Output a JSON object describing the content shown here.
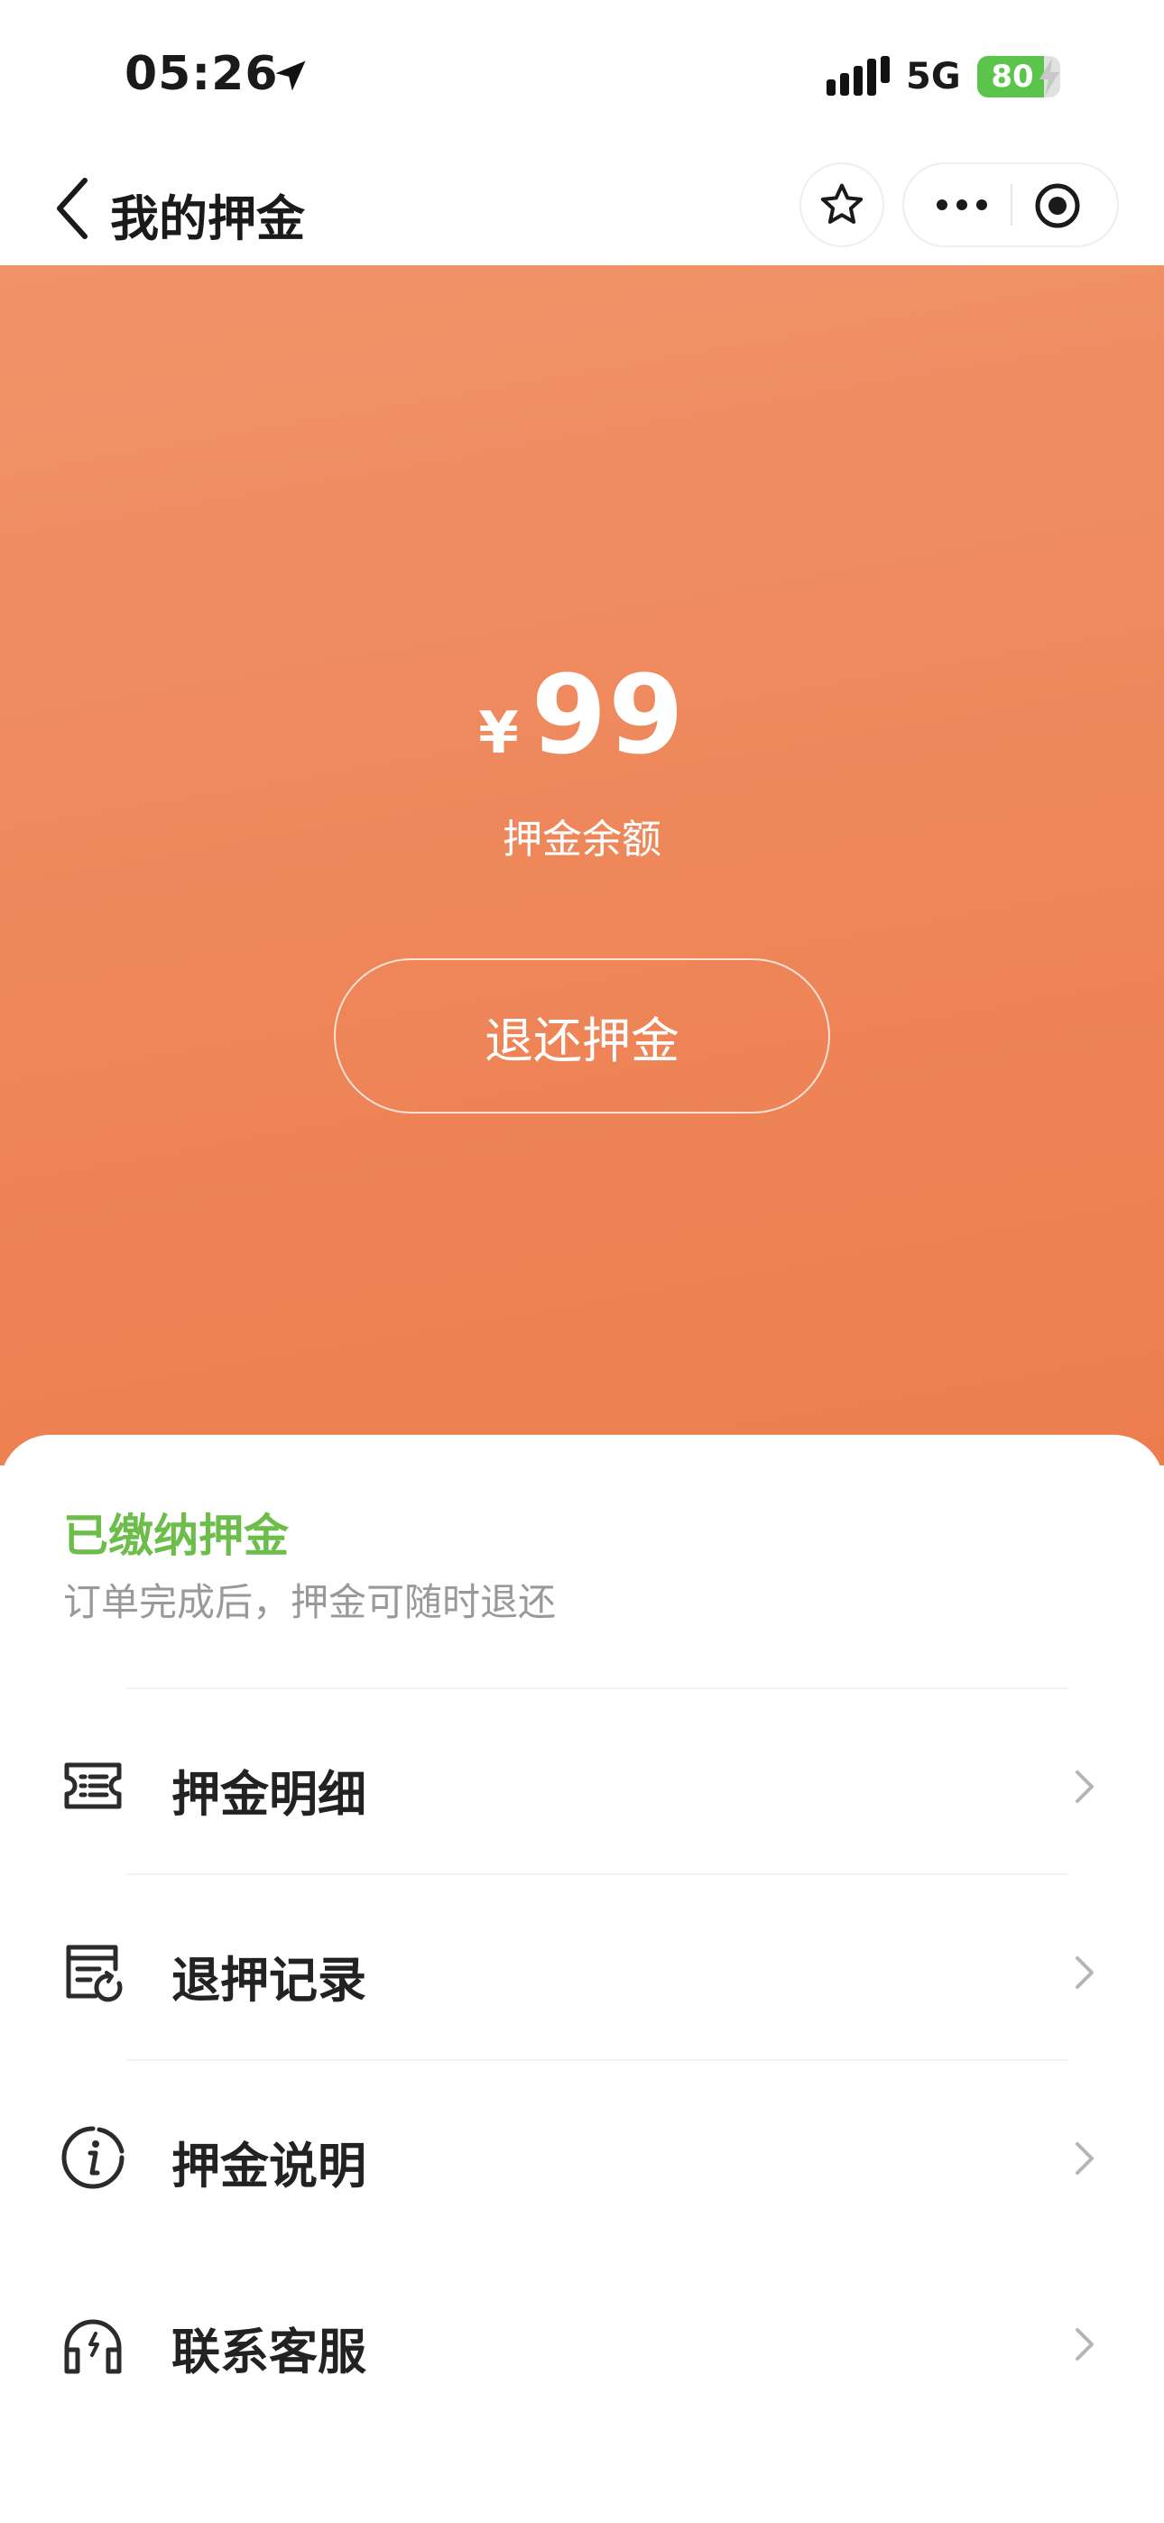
{
  "status_bar": {
    "time": "05:26",
    "network": "5G",
    "battery": "80",
    "battery_level": 0.8,
    "battery_color": "#5bc44a"
  },
  "nav": {
    "title": "我的押金",
    "icons": [
      "back-chevron-icon",
      "star-icon",
      "more-dots-icon",
      "target-icon"
    ]
  },
  "hero": {
    "currency": "¥",
    "amount": "99",
    "label": "押金余额",
    "refund_button": "退还押金",
    "gradient": [
      "#f09369",
      "#ec7e4e"
    ]
  },
  "deposit_status": {
    "title": "已缴纳押金",
    "description": "订单完成后，押金可随时退还",
    "title_color": "#6dbd4a"
  },
  "menu": {
    "items": [
      {
        "label": "押金明细",
        "icon": "ticket-list-icon"
      },
      {
        "label": "退押记录",
        "icon": "refund-record-icon"
      },
      {
        "label": "押金说明",
        "icon": "info-icon"
      },
      {
        "label": "联系客服",
        "icon": "headset-icon"
      }
    ]
  }
}
